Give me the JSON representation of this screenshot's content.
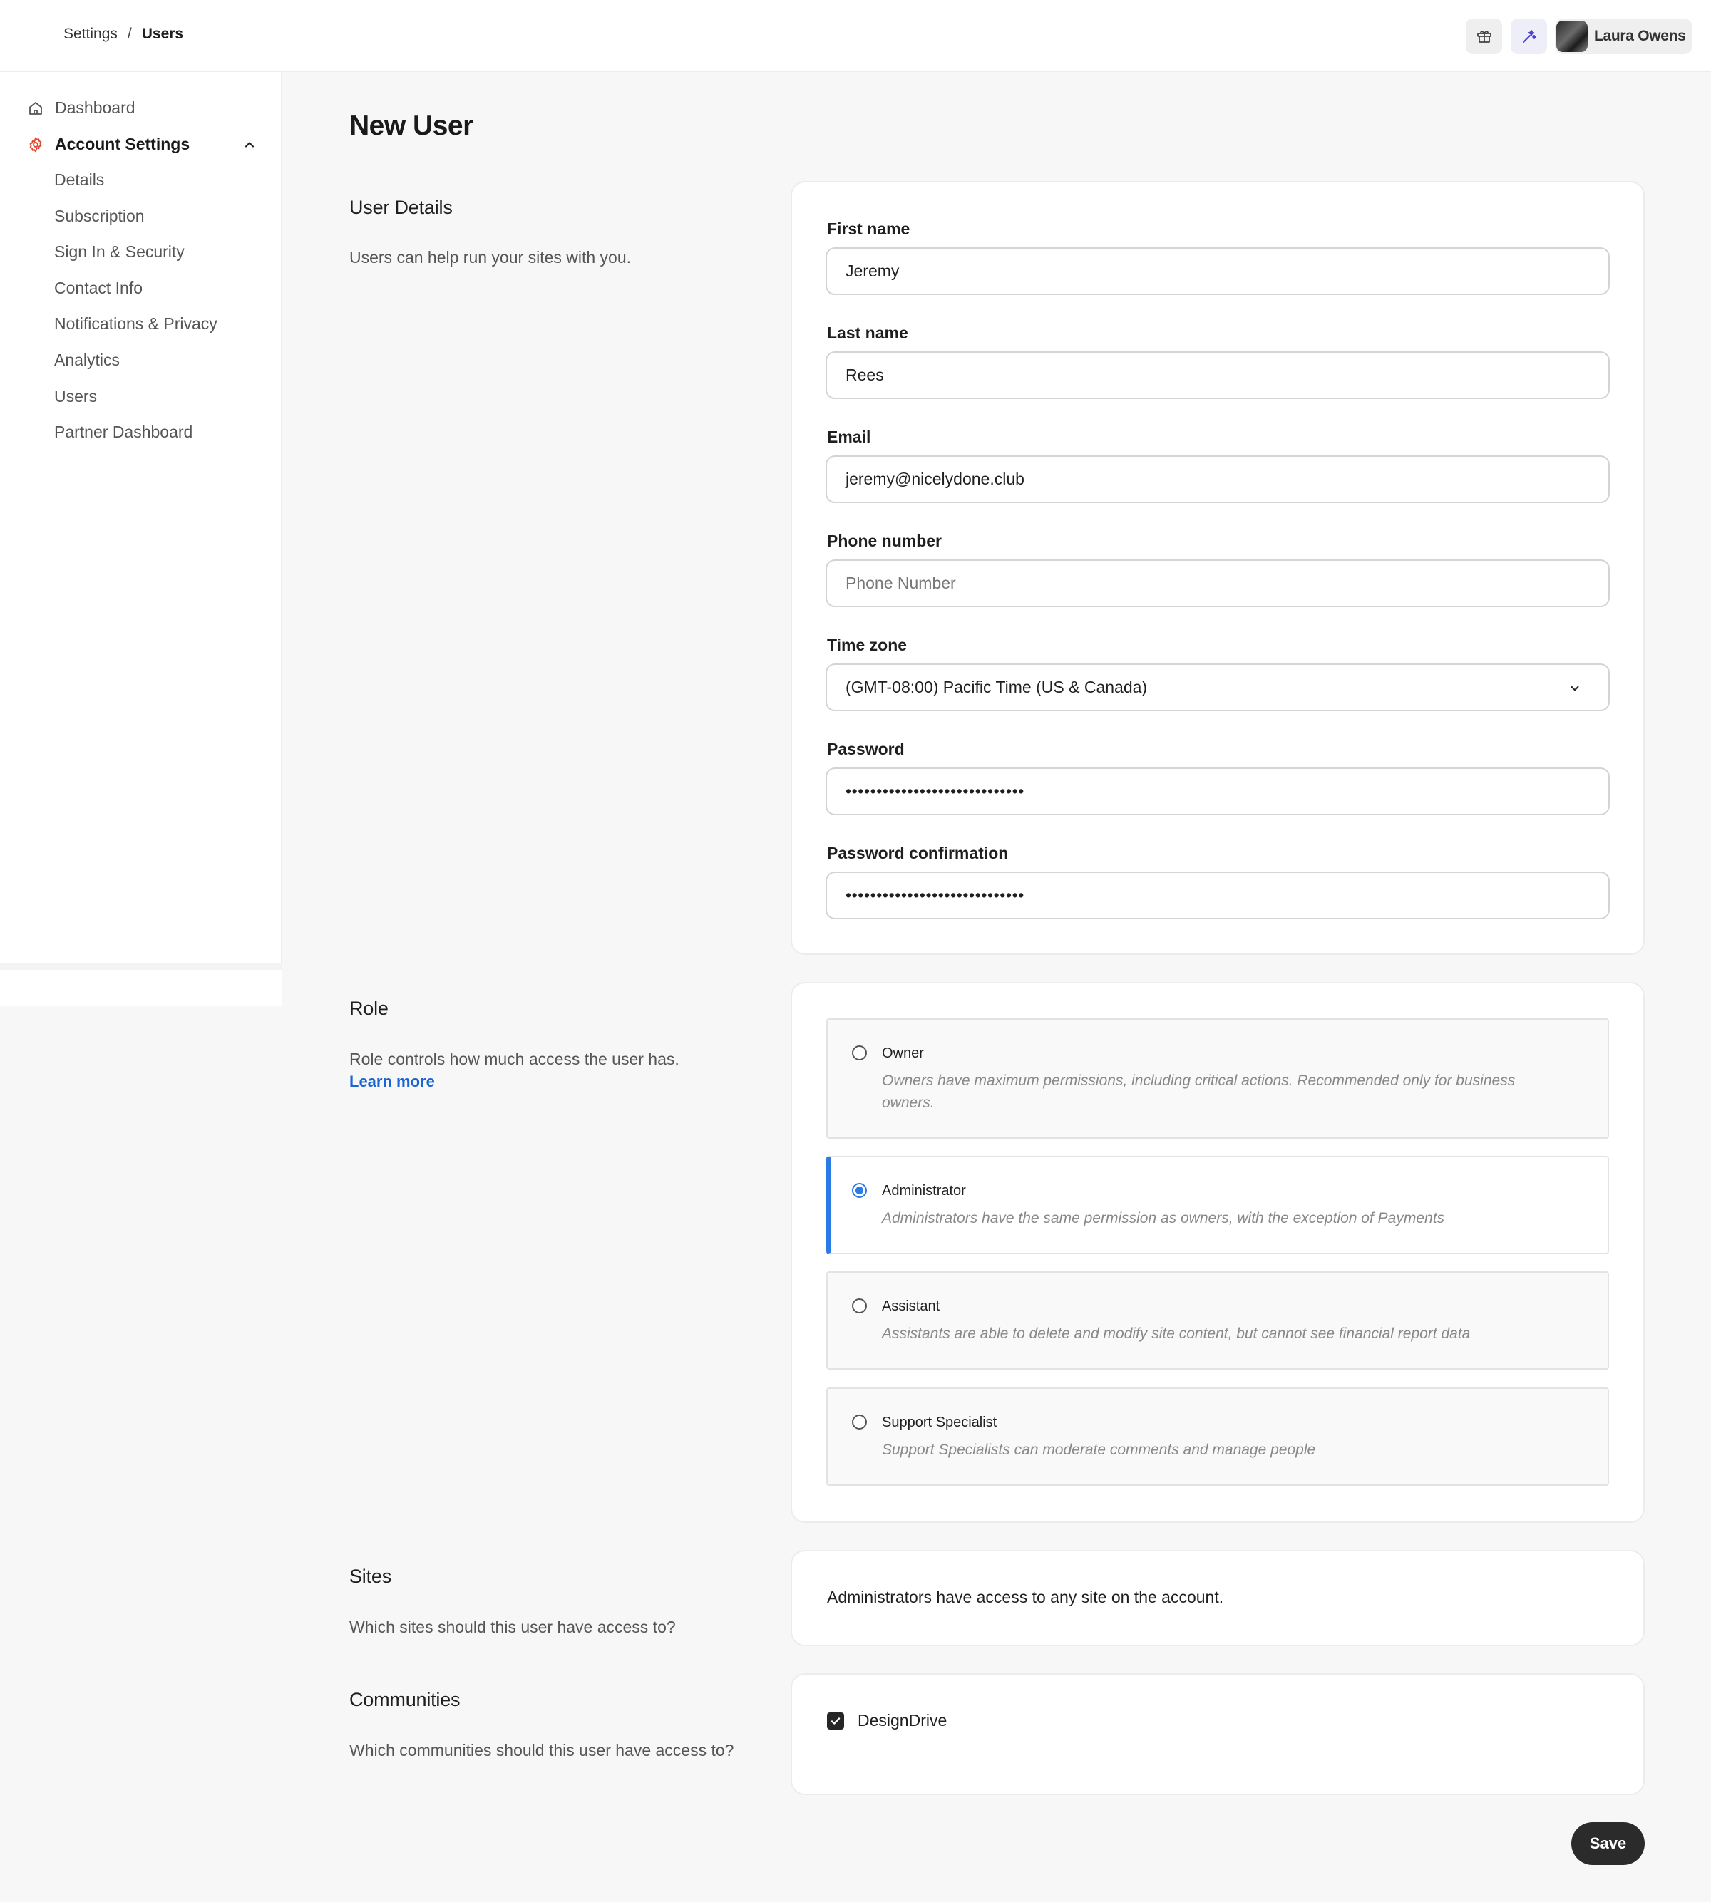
{
  "breadcrumb": {
    "parent": "Settings",
    "separator": "/",
    "current": "Users"
  },
  "header": {
    "user_name": "Laura Owens",
    "icons": [
      "gift-icon",
      "sparkle-icon",
      "avatar"
    ]
  },
  "sidebar": {
    "dashboard": "Dashboard",
    "account_settings": "Account Settings",
    "items": [
      "Details",
      "Subscription",
      "Sign In & Security",
      "Contact Info",
      "Notifications & Privacy",
      "Analytics",
      "Users",
      "Partner Dashboard"
    ]
  },
  "page": {
    "title": "New User"
  },
  "user_details": {
    "title": "User Details",
    "description": "Users can help run your sites with you.",
    "first_name_label": "First name",
    "first_name_value": "Jeremy",
    "last_name_label": "Last name",
    "last_name_value": "Rees",
    "email_label": "Email",
    "email_value": "jeremy@nicelydone.club",
    "phone_label": "Phone number",
    "phone_placeholder": "Phone Number",
    "timezone_label": "Time zone",
    "timezone_value": "(GMT-08:00) Pacific Time (US & Canada)",
    "password_label": "Password",
    "password_value": "•••••••••••••••••••••••••••••",
    "password_confirm_label": "Password confirmation",
    "password_confirm_value": "•••••••••••••••••••••••••••••"
  },
  "role": {
    "title": "Role",
    "description": "Role controls how much access the user has.",
    "learn_more": "Learn more",
    "selected": "Administrator",
    "options": [
      {
        "name": "Owner",
        "description": "Owners have maximum permissions, including critical actions. Recommended only for business owners."
      },
      {
        "name": "Administrator",
        "description": "Administrators have the same permission as owners, with the exception of Payments"
      },
      {
        "name": "Assistant",
        "description": "Assistants are able to delete and modify site content, but cannot see financial report data"
      },
      {
        "name": "Support Specialist",
        "description": "Support Specialists can moderate comments and manage people"
      }
    ]
  },
  "sites": {
    "title": "Sites",
    "description": "Which sites should this user have access to?",
    "info": "Administrators have access to any site on the account."
  },
  "communities": {
    "title": "Communities",
    "description": "Which communities should this user have access to?",
    "items": [
      {
        "name": "DesignDrive",
        "checked": true
      }
    ]
  },
  "actions": {
    "save": "Save"
  },
  "colors": {
    "accent_blue": "#2a7be4",
    "link_blue": "#1a64d6",
    "settings_icon_red": "#e0482f",
    "dark_button": "#2b2b2b"
  }
}
